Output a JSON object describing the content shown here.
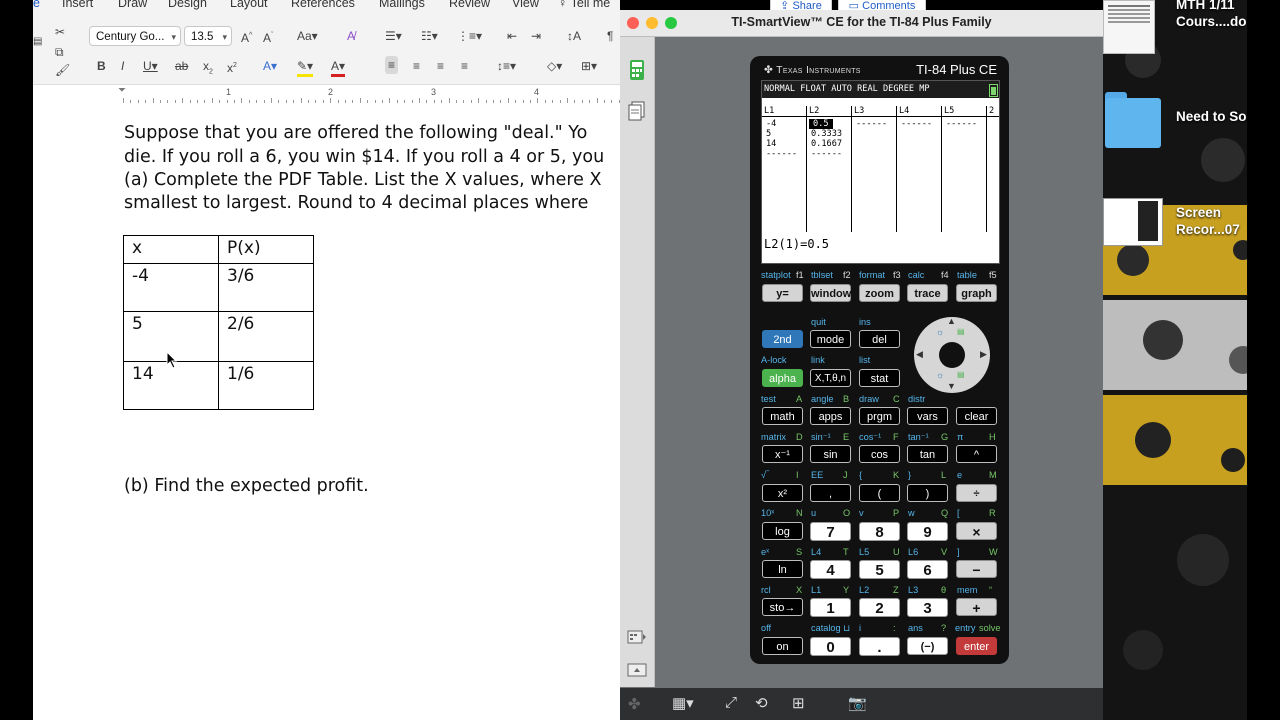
{
  "word": {
    "tabs": [
      "e",
      "Insert",
      "Draw",
      "Design",
      "Layout",
      "References",
      "Mailings",
      "Review",
      "View",
      "Tell me"
    ],
    "font_name": "Century Go...",
    "font_size": "13.5",
    "ruler_numbers": [
      "1",
      "2",
      "3",
      "4"
    ],
    "document": {
      "line1": "Suppose that you are offered the following \"deal.\" Yo",
      "line2": "die. If you roll a 6, you win $14. If you roll a 4 or 5, you",
      "line3": "(a) Complete the PDF Table. List the X values, where X",
      "line4": "smallest to largest. Round to 4 decimal places where",
      "table": {
        "headers": [
          "x",
          "P(x)"
        ],
        "rows": [
          [
            "-4",
            "3/6"
          ],
          [
            "5",
            "2/6"
          ],
          [
            "14",
            "1/6"
          ]
        ]
      },
      "part_b": "(b) Find the expected profit."
    }
  },
  "ti": {
    "window_title": "TI-SmartView™ CE for the TI-84 Plus Family",
    "brand": "Texas Instruments",
    "model": "TI-84 Plus CE",
    "status": "NORMAL FLOAT AUTO REAL DEGREE MP",
    "list_headers": [
      "L1",
      "L2",
      "L3",
      "L4",
      "L5",
      "2"
    ],
    "l1": [
      "-4",
      "5",
      "14",
      "------"
    ],
    "l2": [
      "0.5",
      "0.3333",
      "0.1667",
      "------"
    ],
    "dashes": "------",
    "entry": "L2(1)=0.5",
    "keys": {
      "y": "y=",
      "window": "window",
      "zoom": "zoom",
      "trace": "trace",
      "graph": "graph",
      "second": "2nd",
      "mode": "mode",
      "del": "del",
      "alpha": "alpha",
      "xt": "X,T,θ,n",
      "stat": "stat",
      "math": "math",
      "apps": "apps",
      "prgm": "prgm",
      "vars": "vars",
      "clear": "clear",
      "xinv": "x⁻¹",
      "sin": "sin",
      "cos": "cos",
      "tan": "tan",
      "caret": "^",
      "xsq": "x²",
      "comma": ",",
      "lparen": "(",
      "rparen": ")",
      "div": "÷",
      "log": "log",
      "k7": "7",
      "k8": "8",
      "k9": "9",
      "mul": "×",
      "ln": "ln",
      "k4": "4",
      "k5": "5",
      "k6": "6",
      "minus": "−",
      "sto": "sto→",
      "k1": "1",
      "k2": "2",
      "k3": "3",
      "plus": "+",
      "on": "on",
      "k0": "0",
      "dot": ".",
      "neg": "(−)",
      "enter": "enter"
    },
    "secondary": {
      "statplot": "statplot",
      "f1": "f1",
      "tblset": "tblset",
      "f2": "f2",
      "format": "format",
      "f3": "f3",
      "calc": "calc",
      "f4": "f4",
      "table": "table",
      "f5": "f5",
      "quit": "quit",
      "ins": "ins",
      "alock": "A-lock",
      "link": "link",
      "list": "list",
      "test": "test",
      "A": "A",
      "angle": "angle",
      "B": "B",
      "draw": "draw",
      "C": "C",
      "distr": "distr",
      "matrix": "matrix",
      "D": "D",
      "sininv": "sin⁻¹",
      "E": "E",
      "cosinv": "cos⁻¹",
      "F": "F",
      "taninv": "tan⁻¹",
      "G": "G",
      "pi": "π",
      "H": "H",
      "sqrt": "√‾",
      "I": "I",
      "EE": "EE",
      "J": "J",
      "lbrace": "{",
      "K": "K",
      "rbrace": "}",
      "L": "L",
      "e": "e",
      "M": "M",
      "tenx": "10ˣ",
      "N": "N",
      "u": "u",
      "O": "O",
      "v": "v",
      "P": "P",
      "w": "w",
      "Q": "Q",
      "lbracket": "[",
      "R": "R",
      "ex": "eˣ",
      "S": "S",
      "L4": "L4",
      "T": "T",
      "L5": "L5",
      "U": "U",
      "L6": "L6",
      "V": "V",
      "rbracket": "]",
      "W": "W",
      "rcl": "rcl",
      "X": "X",
      "L1": "L1",
      "Y": "Y",
      "L2": "L2",
      "Z": "Z",
      "L3": "L3",
      "theta": "θ",
      "mem": "mem",
      "quote": "“",
      "off": "off",
      "catalog": "catalog ⊔",
      "i": "i",
      "colon": ":",
      "ans": "ans",
      "qmark": "?",
      "entry": "entry",
      "solve": "solve"
    }
  },
  "desktop": {
    "top_label": "MTH 1/11\nCours....do",
    "share": "Share",
    "comments": "Comments",
    "folder_label": "Need to So",
    "recording_label": "Screen\nRecor...07"
  }
}
